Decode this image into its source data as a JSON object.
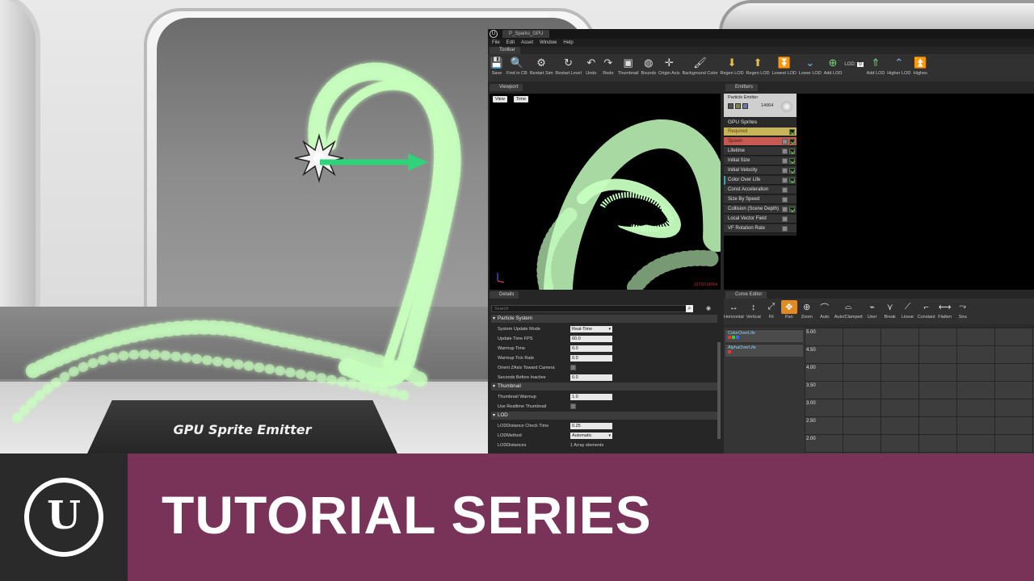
{
  "scene": {
    "plaque_label": "GPU Sprite Emitter"
  },
  "editor": {
    "doc_tab": "P_Sparks_GPU",
    "menu": [
      "File",
      "Edit",
      "Asset",
      "Window",
      "Help"
    ],
    "panels": {
      "toolbar": "Toolbar",
      "viewport": "Viewport",
      "emitters": "Emitters",
      "details": "Details",
      "curve_editor": "Curve Editor"
    },
    "toolbar_buttons": [
      {
        "label": "Save",
        "icon": "save-icon"
      },
      {
        "label": "Find in CB",
        "icon": "find-icon"
      },
      {
        "label": "Restart Sim",
        "icon": "restart-sim-icon"
      },
      {
        "label": "Restart Level",
        "icon": "restart-level-icon"
      },
      {
        "label": "Undo",
        "icon": "undo-icon"
      },
      {
        "label": "Redo",
        "icon": "redo-icon"
      },
      {
        "label": "Thumbnail",
        "icon": "thumbnail-icon"
      },
      {
        "label": "Bounds",
        "icon": "bounds-icon"
      },
      {
        "label": "Origin Axis",
        "icon": "origin-axis-icon"
      },
      {
        "label": "Background Color",
        "icon": "brush-icon"
      },
      {
        "label": "Regen LOD",
        "icon": "regen-lod-icon"
      },
      {
        "label": "Regen LOD",
        "icon": "regen-lod-icon"
      },
      {
        "label": "Lowest LOD",
        "icon": "lowest-lod-icon"
      },
      {
        "label": "Lower LOD",
        "icon": "lower-lod-icon"
      },
      {
        "label": "Add LOD",
        "icon": "add-lod-icon"
      }
    ],
    "lod_label": "LOD:",
    "lod_value": "0",
    "toolbar_buttons_right": [
      {
        "label": "Add LOD",
        "icon": "add-lod-icon"
      },
      {
        "label": "Higher LOD",
        "icon": "higher-lod-icon"
      },
      {
        "label": "Highes",
        "icon": "highest-lod-icon"
      }
    ],
    "viewport": {
      "view_btn": "View",
      "time_btn": "Time",
      "particle_count": "13792/14064"
    },
    "emitter": {
      "name": "Particle Emitter",
      "count": "14064",
      "type": "GPU Sprites",
      "modules": [
        {
          "label": "Required",
          "kind": "req"
        },
        {
          "label": "Spawn",
          "kind": "spawn"
        },
        {
          "label": "Lifetime",
          "kind": "normal"
        },
        {
          "label": "Initial Size",
          "kind": "normal"
        },
        {
          "label": "Initial Velocity",
          "kind": "normal"
        },
        {
          "label": "Color Over Life",
          "kind": "color"
        },
        {
          "label": "Const Acceleration",
          "kind": "normal"
        },
        {
          "label": "Size By Speed",
          "kind": "normal"
        },
        {
          "label": "Collision (Scene Depth)",
          "kind": "normal"
        },
        {
          "label": "Local Vector Field",
          "kind": "normal"
        },
        {
          "label": "VF Rotation Rate",
          "kind": "normal"
        }
      ]
    },
    "details": {
      "search_placeholder": "Search",
      "sections": [
        {
          "title": "Particle System",
          "rows": [
            {
              "label": "System Update Mode",
              "value": "Real-Time",
              "kind": "dropdown"
            },
            {
              "label": "Update Time FPS",
              "value": "60.0",
              "kind": "number"
            },
            {
              "label": "Warmup Time",
              "value": "0.0",
              "kind": "number"
            },
            {
              "label": "Warmup Tick Rate",
              "value": "0.0",
              "kind": "number"
            },
            {
              "label": "Orient ZAxis Toward Camera",
              "value": "",
              "kind": "checkbox"
            },
            {
              "label": "Seconds Before Inactive",
              "value": "0.0",
              "kind": "number"
            }
          ]
        },
        {
          "title": "Thumbnail",
          "rows": [
            {
              "label": "Thumbnail Warmup",
              "value": "1.0",
              "kind": "number"
            },
            {
              "label": "Use Realtime Thumbnail",
              "value": "",
              "kind": "checkbox"
            }
          ]
        },
        {
          "title": "LOD",
          "rows": [
            {
              "label": "LODDistance Check Time",
              "value": "0.25",
              "kind": "number"
            },
            {
              "label": "LODMethod",
              "value": "Automatic",
              "kind": "dropdown"
            },
            {
              "label": "LODDistances",
              "value": "1 Array elements",
              "kind": "text"
            }
          ]
        }
      ]
    },
    "curve_editor": {
      "buttons": [
        {
          "label": "Horizontal",
          "icon": "fit-horizontal-icon"
        },
        {
          "label": "Vertical",
          "icon": "fit-vertical-icon"
        },
        {
          "label": "Fit",
          "icon": "fit-icon"
        },
        {
          "label": "Pan",
          "icon": "pan-icon",
          "selected": true
        },
        {
          "label": "Zoom",
          "icon": "zoom-icon"
        },
        {
          "label": "Auto",
          "icon": "auto-tangent-icon"
        },
        {
          "label": "Auto/Clamped",
          "icon": "auto-clamped-icon"
        },
        {
          "label": "User",
          "icon": "user-tangent-icon"
        },
        {
          "label": "Break",
          "icon": "break-tangent-icon"
        },
        {
          "label": "Linear",
          "icon": "linear-icon"
        },
        {
          "label": "Constant",
          "icon": "constant-icon"
        },
        {
          "label": "Flatten",
          "icon": "flatten-icon"
        },
        {
          "label": "Stra",
          "icon": "straighten-icon"
        }
      ],
      "curves": [
        "ColorOverLife",
        "AlphaOverLife"
      ],
      "y_ticks": [
        "5.00",
        "4.50",
        "4.00",
        "3.50",
        "3.00",
        "2.50",
        "2.00"
      ]
    }
  },
  "banner": {
    "title": "TUTORIAL SERIES",
    "logo": "unreal-engine-logo"
  },
  "colors": {
    "banner": "#7a3358",
    "particles": "#b8ffb0",
    "arrow": "#2fd37a",
    "pan_selected": "#e08a22"
  }
}
